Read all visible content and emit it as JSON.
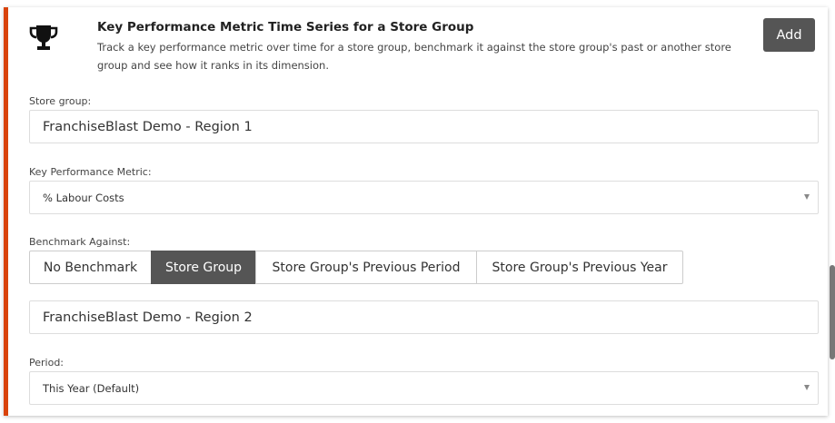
{
  "widget": {
    "title": "Key Performance Metric Time Series for a Store Group",
    "description": "Track a key performance metric over time for a store group, benchmark it against the store group's past or another store group and see how it ranks in its dimension.",
    "add_label": "Add",
    "accent_color": "#d9430b",
    "icon": "trophy-icon"
  },
  "form": {
    "store_group": {
      "label": "Store group:",
      "value": "FranchiseBlast Demo - Region 1"
    },
    "kpi": {
      "label": "Key Performance Metric:",
      "value": "% Labour Costs"
    },
    "benchmark": {
      "label": "Benchmark Against:",
      "options": [
        "No Benchmark",
        "Store Group",
        "Store Group's Previous Period",
        "Store Group's Previous Year"
      ],
      "selected": "Store Group",
      "compare_value": "FranchiseBlast Demo - Region 2"
    },
    "period": {
      "label": "Period:",
      "value": "This Year (Default)"
    }
  }
}
